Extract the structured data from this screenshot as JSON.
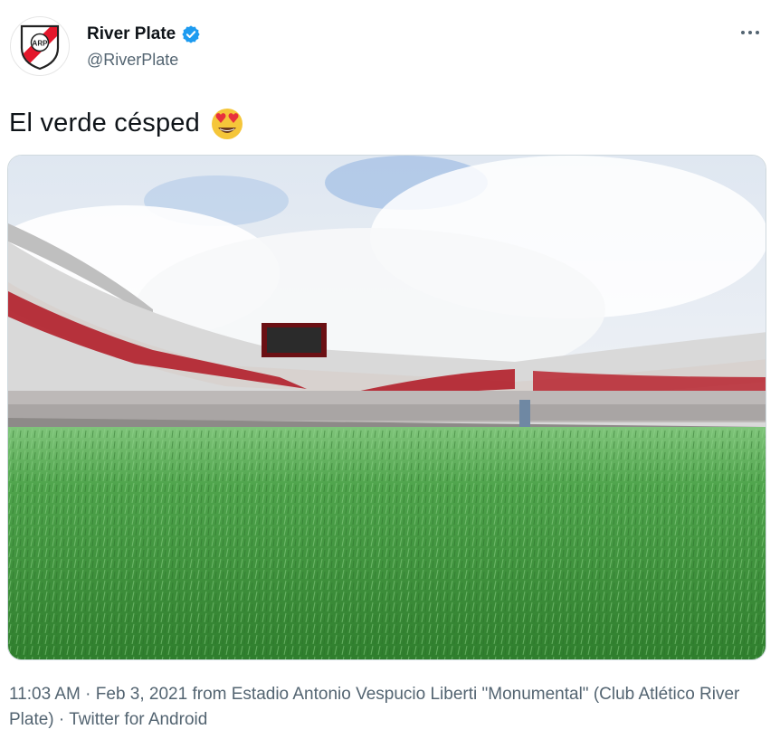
{
  "author": {
    "display_name": "River Plate",
    "handle": "@RiverPlate",
    "avatar_icon": "river-plate-crest-icon",
    "verified_icon": "verified-badge-icon"
  },
  "menu": {
    "more_icon": "more-horizontal-icon",
    "more_label": "···"
  },
  "tweet": {
    "text": "El verde césped",
    "emoji": "smiling-face-with-heart-eyes-icon"
  },
  "media": {
    "description_icon": "stadium-photo"
  },
  "meta": {
    "time": "11:03 AM",
    "sep1": " · ",
    "date": "Feb 3, 2021",
    "from": " from ",
    "location": "Estadio Antonio Vespucio Liberti \"Monumental\" (Club Atlético River Plate)",
    "sep2": " · ",
    "source": "Twitter for Android"
  },
  "colors": {
    "verified": "#1d9bf0",
    "text": "#0f1419",
    "secondary": "#536471",
    "crest_red": "#e4172b"
  }
}
